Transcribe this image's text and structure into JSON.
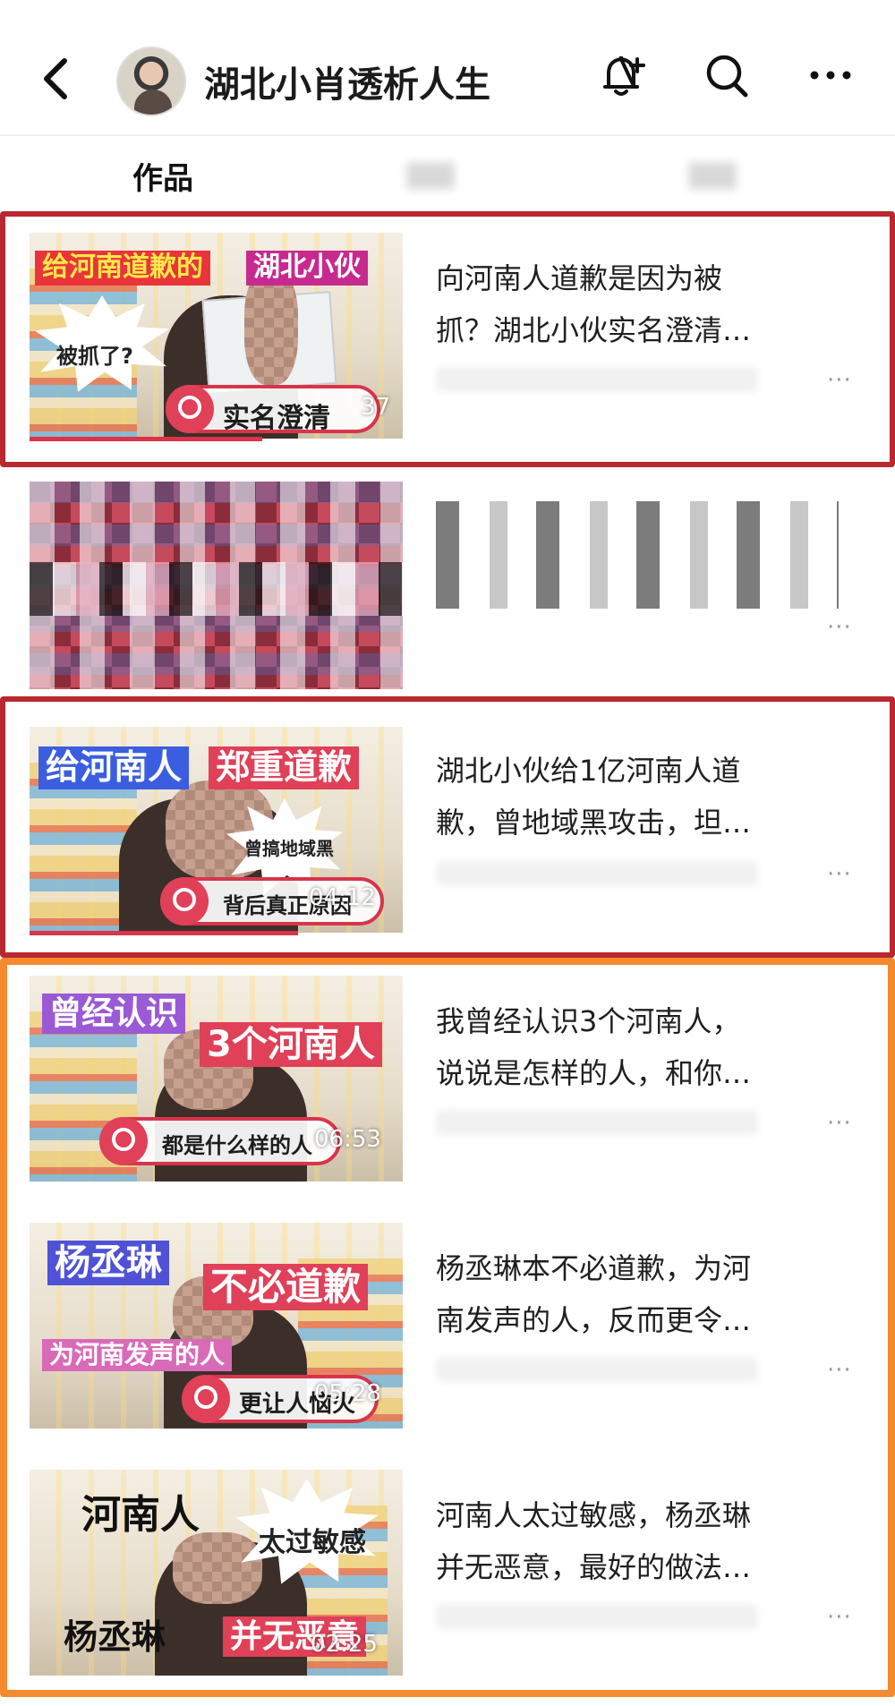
{
  "header": {
    "back_icon": "chevron-left-icon",
    "title": "湖北小肖透析人生",
    "bell_icon": "bell-plus-icon",
    "search_icon": "search-icon",
    "more_icon": "more-dots-icon"
  },
  "tabs": [
    {
      "label": "作品",
      "active": true
    }
  ],
  "videos": [
    {
      "title_l1": "向河南人道歉是因为被",
      "title_l2": "抓？湖北小伙实名澄清…",
      "label_a": "给河南道歉的",
      "label_b": "湖北小伙",
      "burst": "被抓了?",
      "pill": "实名澄清",
      "duration": "37"
    },
    {
      "title_l1": "",
      "title_l2": "",
      "blurred": true
    },
    {
      "title_l1": "湖北小伙给1亿河南人道",
      "title_l2": "歉，曾地域黑攻击，坦…",
      "label_a": "给河南人",
      "label_b": "郑重道歉",
      "burst": "曾搞地域黑",
      "pill": "背后真正原因",
      "duration": "04:12"
    },
    {
      "title_l1": "我曾经认识3个河南人，",
      "title_l2": "说说是怎样的人，和你…",
      "label_a": "曾经认识",
      "label_b": "3个河南人",
      "pill": "都是什么样的人",
      "duration": "06:53"
    },
    {
      "title_l1": "杨丞琳本不必道歉，为河",
      "title_l2": "南发声的人，反而更令…",
      "label_a": "杨丞琳",
      "label_b": "不必道歉",
      "label_c": "为河南发声的人",
      "pill": "更让人恼火",
      "duration": "05:28"
    },
    {
      "title_l1": "河南人太过敏感，杨丞琳",
      "title_l2": "并无恶意，最好的做法…",
      "label_a": "河南人",
      "burst": "太过敏感",
      "label_b": "杨丞琳",
      "label_c": "并无恶意",
      "duration": "02:25"
    }
  ],
  "more_label": "···",
  "colors": {
    "highlight_red": "#b8282e",
    "highlight_orange": "#f5892e",
    "accent_pink": "#e04058"
  }
}
